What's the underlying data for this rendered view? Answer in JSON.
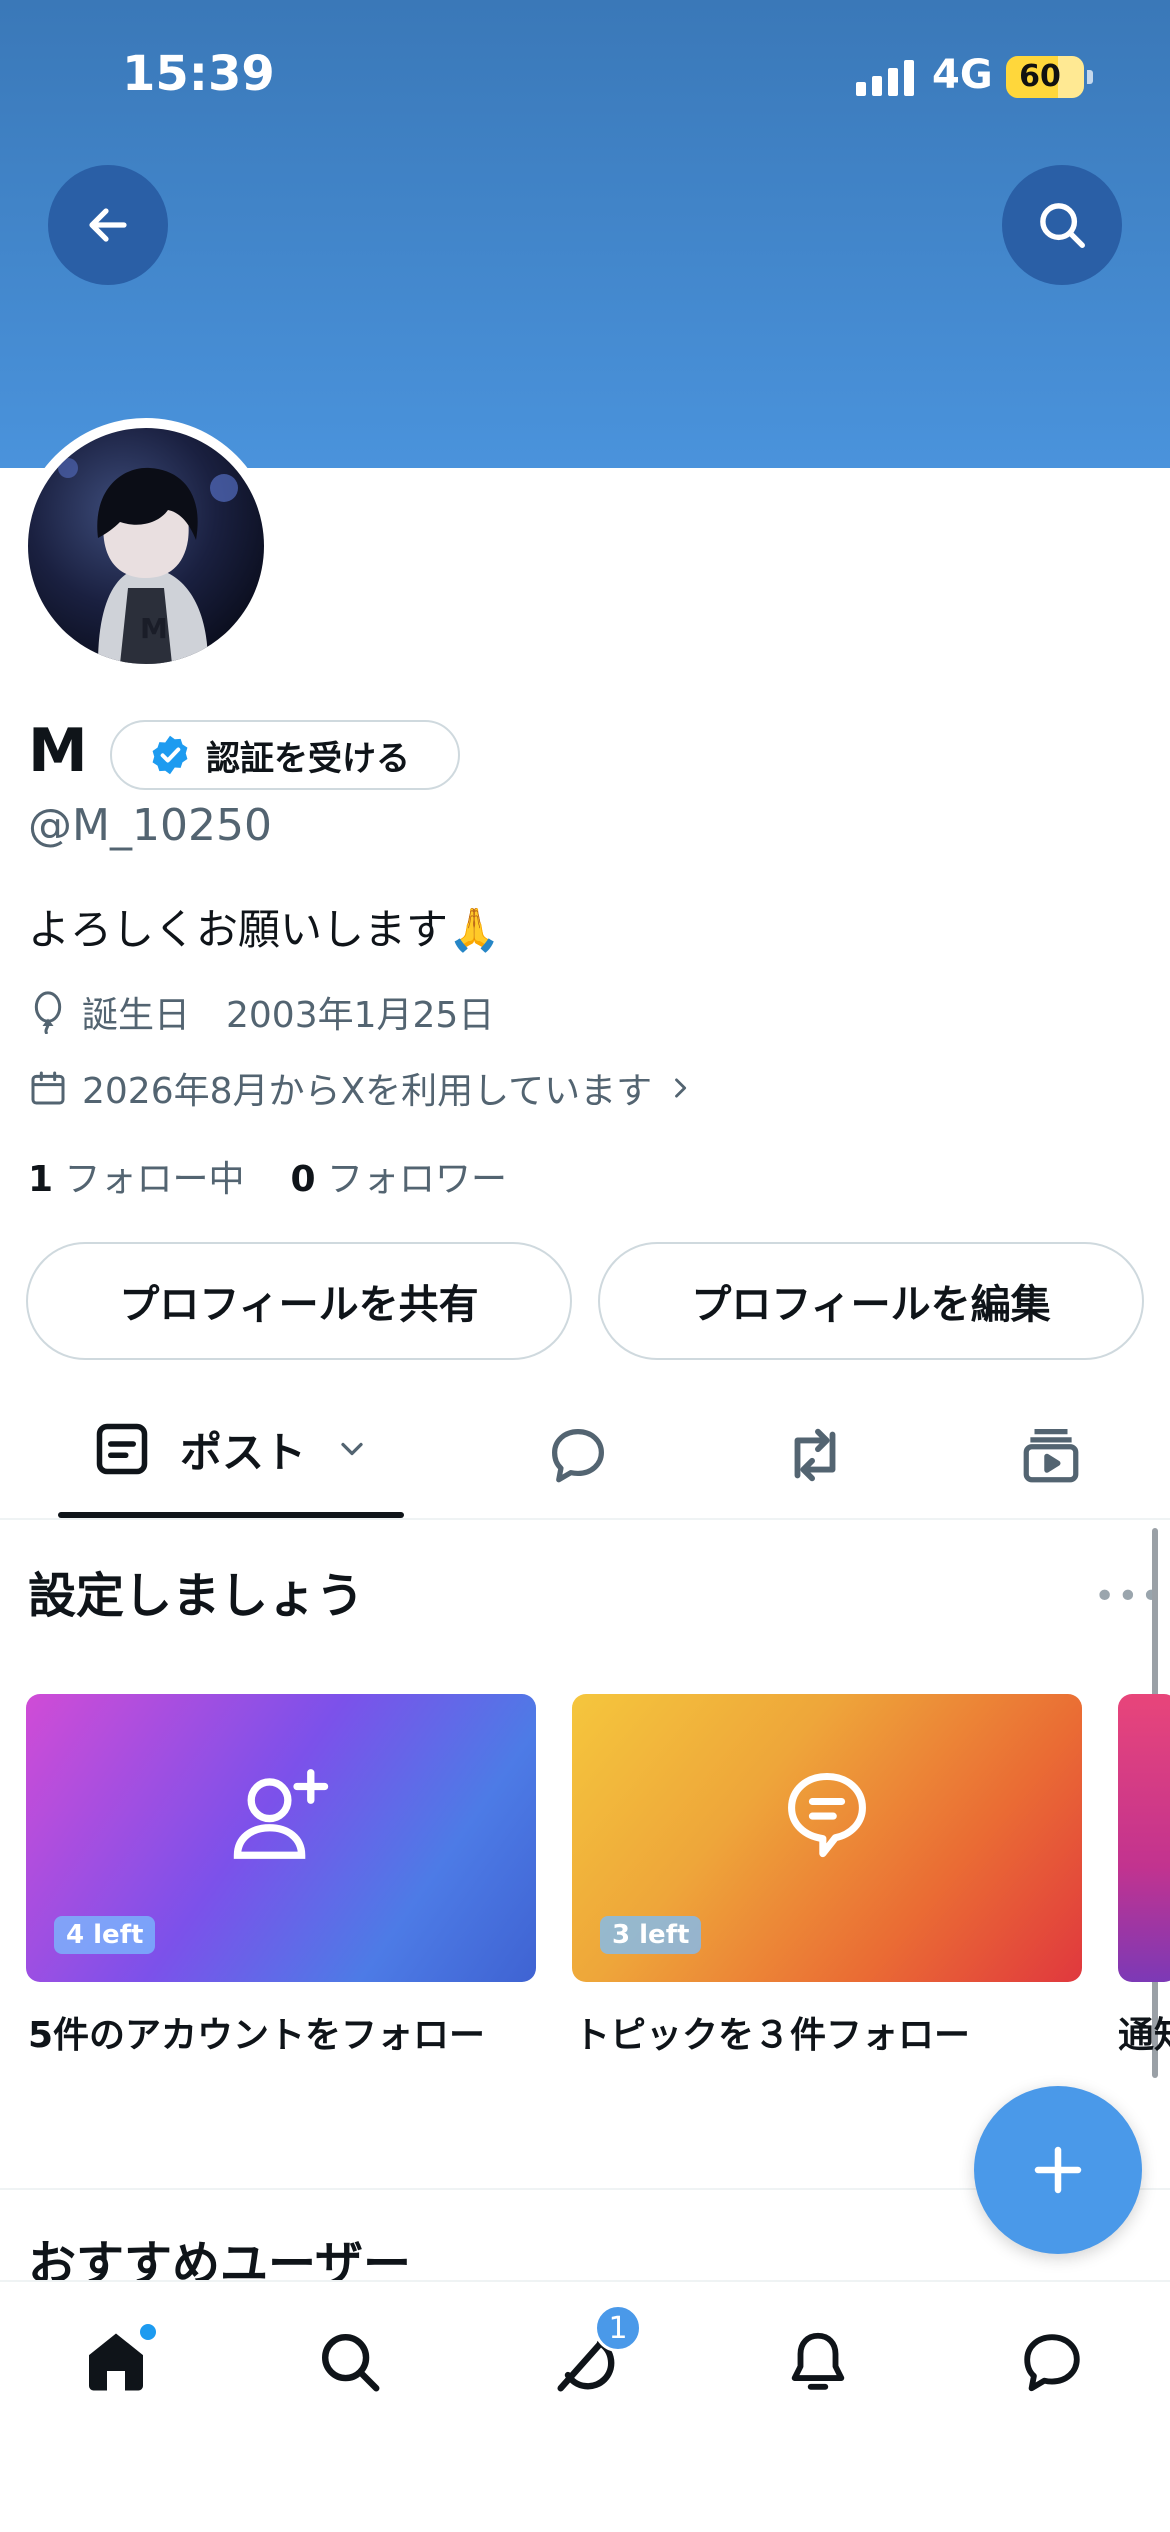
{
  "status_bar": {
    "time": "15:39",
    "network": "4G",
    "battery": "60"
  },
  "profile": {
    "name": "M",
    "verify_label": "認証を受ける",
    "handle": "@M_10250",
    "bio": "よろしくお願いします🙏",
    "birthday": "誕生日　2003年1月25日",
    "joined": "2026年8月からXを利用しています",
    "following_count": "1",
    "following_label": "フォロー中",
    "followers_count": "0",
    "followers_label": "フォロワー",
    "share_label": "プロフィールを共有",
    "edit_label": "プロフィールを編集"
  },
  "tabs": {
    "active_label": "ポスト"
  },
  "setup": {
    "title": "設定しましょう",
    "cards": [
      {
        "badge": "4 left",
        "label": "5件のアカウントをフォロー"
      },
      {
        "badge": "3 left",
        "label": "トピックを３件フォロー"
      },
      {
        "badge": "",
        "label": "通知"
      }
    ]
  },
  "recommended": {
    "title": "おすすめユーザー"
  },
  "bottom_nav": {
    "messages_badge": "1"
  },
  "colors": {
    "accent": "#1d9bf0",
    "banner_top": "#3a78b8",
    "banner_bottom": "#4a93dc",
    "fab": "#4a99e9"
  }
}
